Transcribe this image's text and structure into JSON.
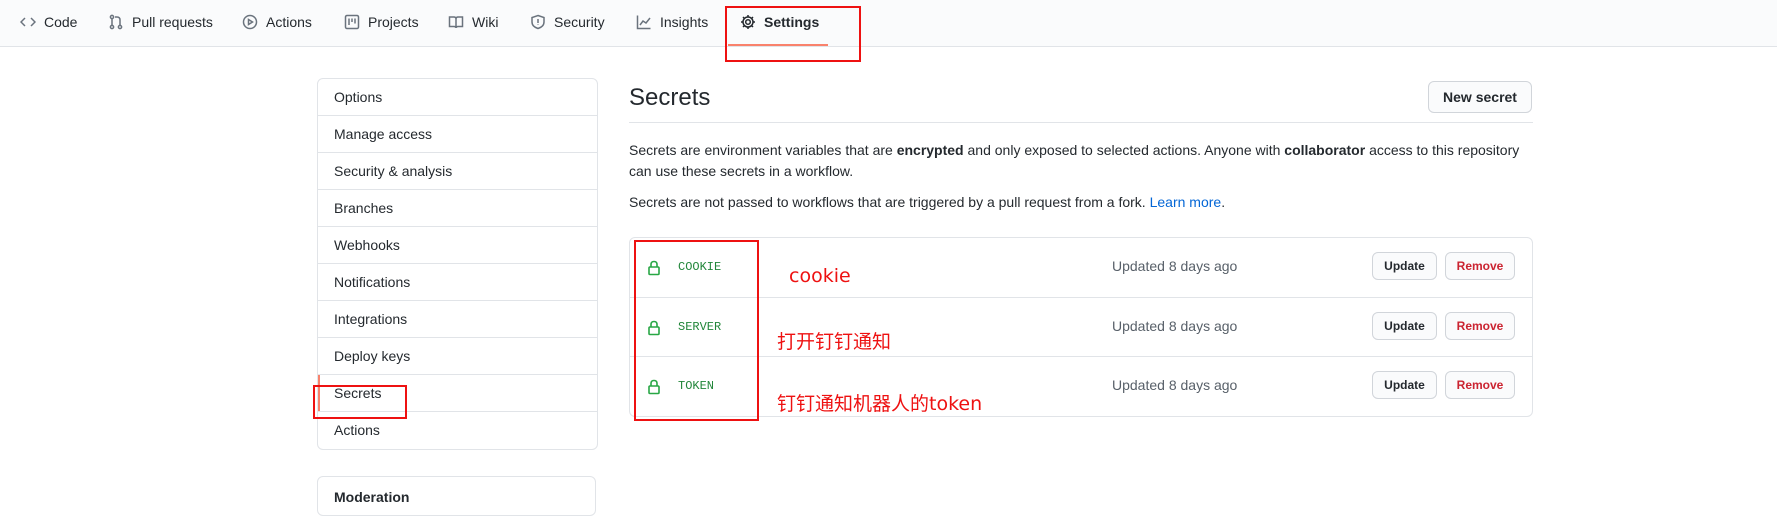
{
  "repo_nav": {
    "tabs": [
      {
        "label": "Code",
        "icon": "code-icon"
      },
      {
        "label": "Pull requests",
        "icon": "pull-request-icon"
      },
      {
        "label": "Actions",
        "icon": "play-icon"
      },
      {
        "label": "Projects",
        "icon": "project-icon"
      },
      {
        "label": "Wiki",
        "icon": "book-icon"
      },
      {
        "label": "Security",
        "icon": "shield-icon"
      },
      {
        "label": "Insights",
        "icon": "graph-icon"
      },
      {
        "label": "Settings",
        "icon": "gear-icon",
        "active": true
      }
    ]
  },
  "sidebar": {
    "items": [
      {
        "label": "Options"
      },
      {
        "label": "Manage access"
      },
      {
        "label": "Security & analysis"
      },
      {
        "label": "Branches"
      },
      {
        "label": "Webhooks"
      },
      {
        "label": "Notifications"
      },
      {
        "label": "Integrations"
      },
      {
        "label": "Deploy keys"
      },
      {
        "label": "Secrets",
        "selected": true
      },
      {
        "label": "Actions"
      }
    ],
    "moderation_label": "Moderation"
  },
  "main": {
    "title": "Secrets",
    "new_secret_label": "New secret",
    "intro_1": "Secrets are environment variables that are",
    "intro_bold_1": "encrypted",
    "intro_2": "and only exposed to selected actions. Anyone with",
    "intro_bold_2": "collaborator",
    "intro_3": "access to this repository can use these secrets in a workflow.",
    "note": "Secrets are not passed to workflows that are triggered by a pull request from a fork.",
    "learn_more": "Learn more",
    "secrets": [
      {
        "name": "COOKIE",
        "updated": "Updated 8 days ago",
        "update_label": "Update",
        "remove_label": "Remove"
      },
      {
        "name": "SERVER",
        "updated": "Updated 8 days ago",
        "update_label": "Update",
        "remove_label": "Remove"
      },
      {
        "name": "TOKEN",
        "updated": "Updated 8 days ago",
        "update_label": "Update",
        "remove_label": "Remove"
      }
    ]
  },
  "annotations": {
    "cookie": "cookie",
    "server": "打开钉钉通知",
    "token": "钉钉通知机器人的token",
    "color": "#ee1111"
  },
  "colors": {
    "accent_underline": "#f9826c",
    "secret_name": "#22863a",
    "link": "#0366d6",
    "remove": "#cb2431"
  }
}
